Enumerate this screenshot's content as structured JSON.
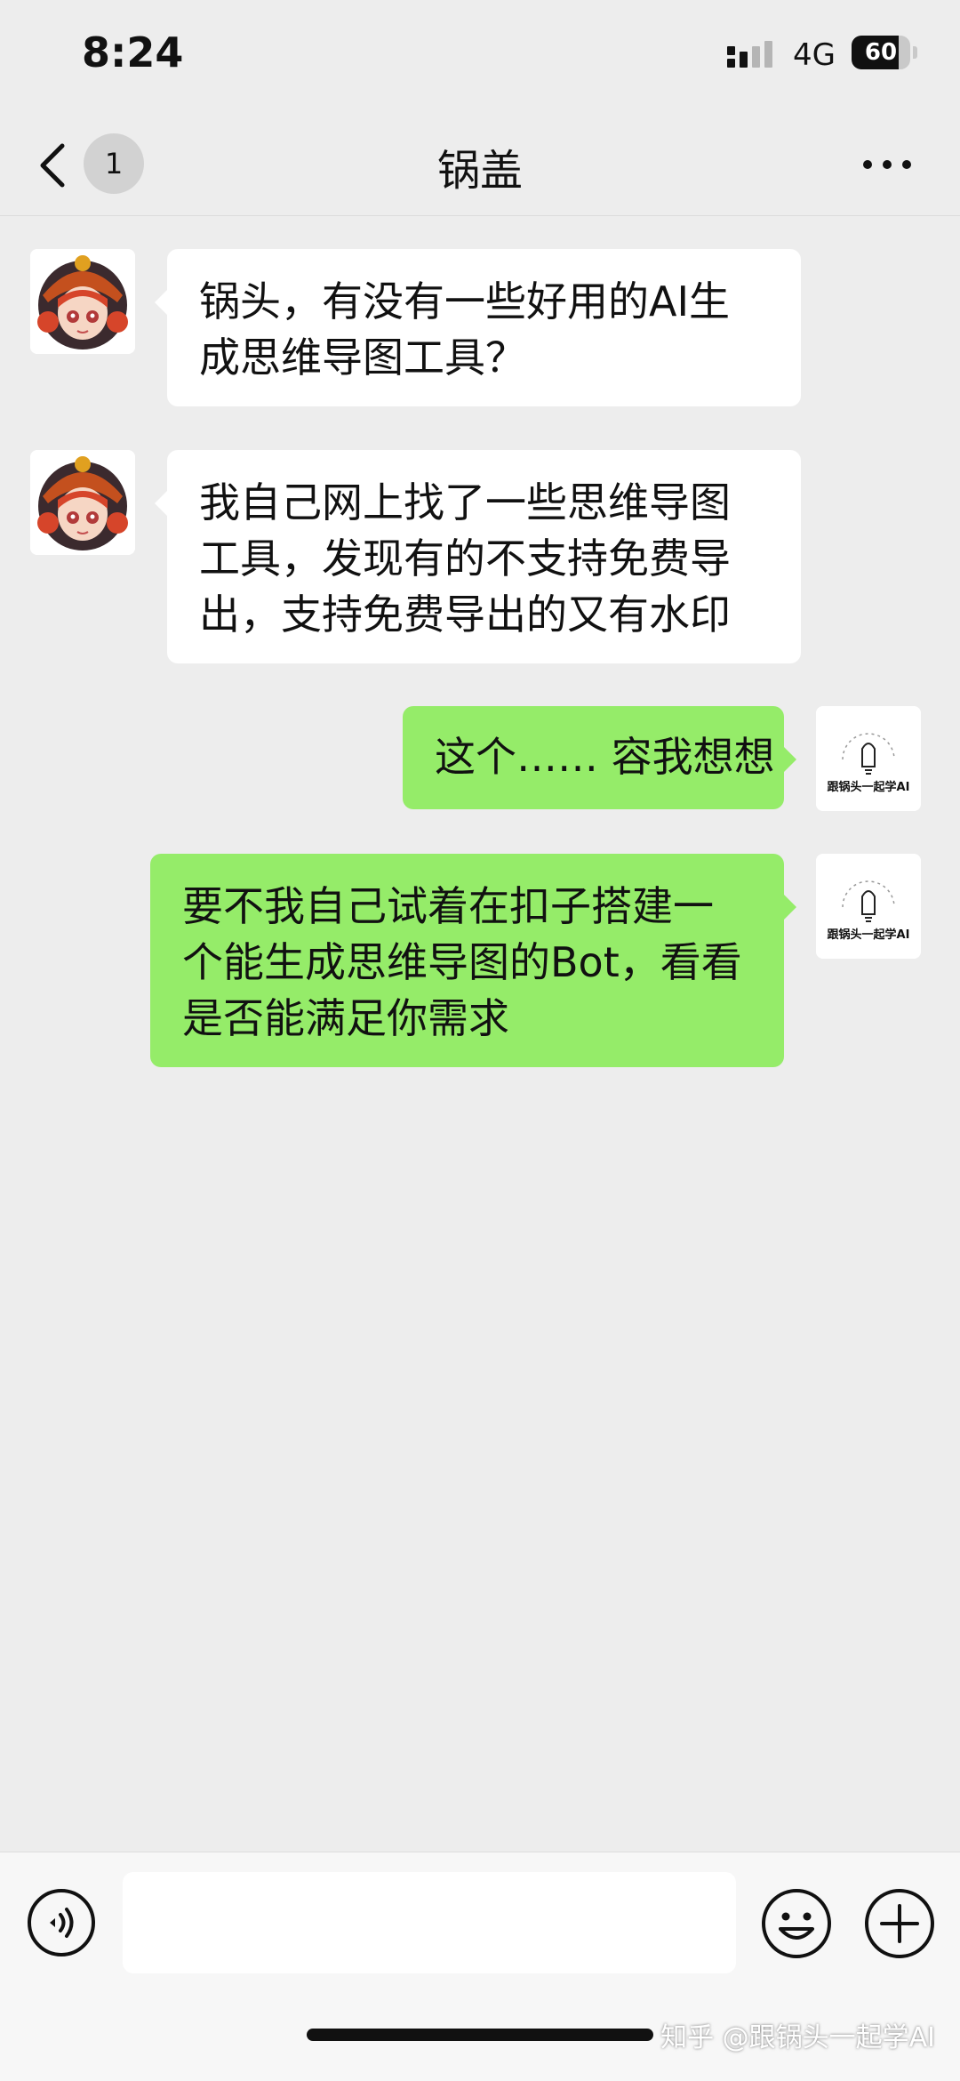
{
  "status_bar": {
    "time": "8:24",
    "network": "4G",
    "battery": "60",
    "signal_icon": "signal-bars-icon"
  },
  "nav": {
    "back_icon": "chevron-left-icon",
    "unread_count": "1",
    "title": "锅盖",
    "more_icon": "more-dots-icon"
  },
  "messages": [
    {
      "sender": "other",
      "text": "锅头，有没有一些好用的AI生成思维导图工具？"
    },
    {
      "sender": "other",
      "text": "我自己网上找了一些思维导图工具，发现有的不支持免费导出，支持免费导出的又有水印"
    },
    {
      "sender": "self",
      "text": "这个…… 容我想想"
    },
    {
      "sender": "self",
      "text": "要不我自己试着在扣子搭建一个能生成思维导图的Bot，看看是否能满足你需求"
    }
  ],
  "self_avatar_label": "跟锅头一起学AI",
  "input_bar": {
    "voice_icon": "voice-icon",
    "input_value": "",
    "emoji_icon": "emoji-icon",
    "plus_icon": "plus-circle-icon"
  },
  "watermark": "知乎 @跟锅头一起学AI",
  "colors": {
    "background": "#EDEDED",
    "outgoing_bubble": "#95EC69",
    "incoming_bubble": "#FFFFFF"
  }
}
